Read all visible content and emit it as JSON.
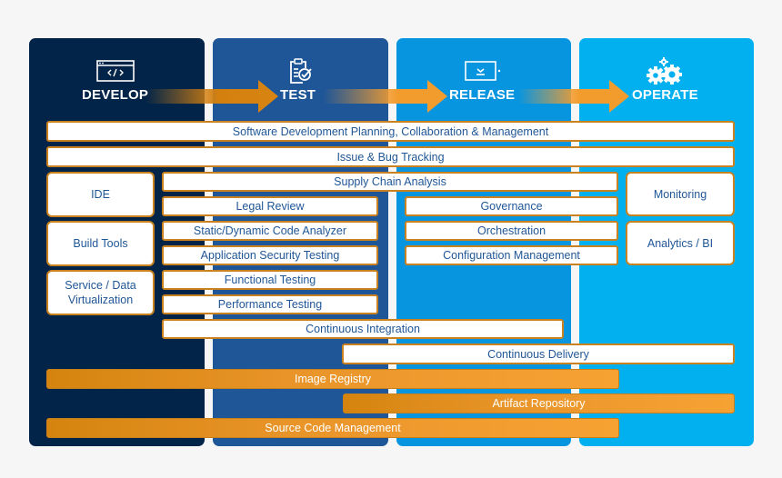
{
  "phases": [
    {
      "name": "DEVELOP",
      "icon": "code-window-icon",
      "color": "#022448"
    },
    {
      "name": "TEST",
      "icon": "clipboard-check-icon",
      "color": "#1f5697"
    },
    {
      "name": "RELEASE",
      "icon": "download-device-icon",
      "color": "#0895e0"
    },
    {
      "name": "OPERATE",
      "icon": "gears-icon",
      "color": "#03b0ef"
    }
  ],
  "accent_color": "#f39c2e",
  "tools": {
    "planning": "Software Development Planning, Collaboration & Management",
    "issue_tracking": "Issue & Bug Tracking",
    "ide": "IDE",
    "build_tools": "Build Tools",
    "service_virtualization": "Service / Data Virtualization",
    "supply_chain": "Supply Chain Analysis",
    "legal_review": "Legal Review",
    "code_analyzer": "Static/Dynamic Code Analyzer",
    "app_security": "Application Security Testing",
    "functional_testing": "Functional Testing",
    "performance_testing": "Performance Testing",
    "governance": "Governance",
    "orchestration": "Orchestration",
    "config_management": "Configuration Management",
    "monitoring": "Monitoring",
    "analytics": "Analytics / BI",
    "continuous_integration": "Continuous Integration",
    "continuous_delivery": "Continuous Delivery"
  },
  "repositories": {
    "image_registry": "Image Registry",
    "artifact_repository": "Artifact Repository",
    "source_code_management": "Source Code Management"
  }
}
